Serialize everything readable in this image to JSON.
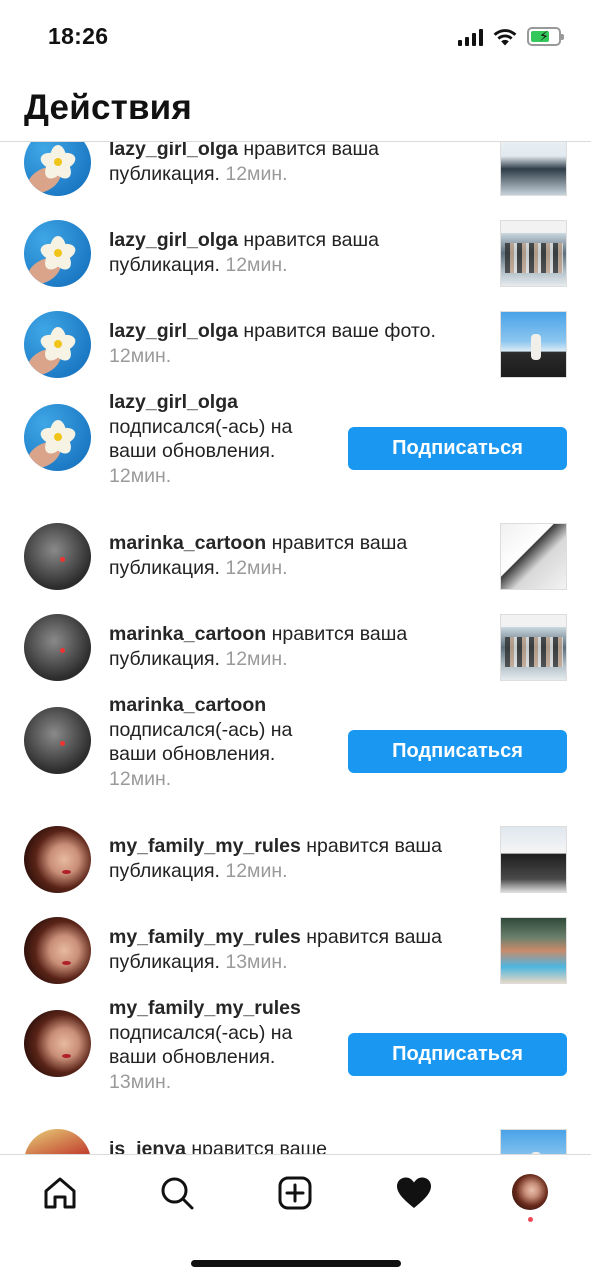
{
  "status_bar": {
    "time": "18:26"
  },
  "header": {
    "title": "Действия"
  },
  "notifications": [
    {
      "type": "like",
      "username": "lazy_girl_olga",
      "action": " нравится ваша публикация. ",
      "time": "12мин."
    },
    {
      "type": "like",
      "username": "lazy_girl_olga",
      "action": " нравится ваша публикация. ",
      "time": "12мин."
    },
    {
      "type": "like",
      "username": "lazy_girl_olga",
      "action": " нравится ваше фото. ",
      "time": "12мин."
    },
    {
      "type": "follow",
      "username": "lazy_girl_olga",
      "action": " подписался(-ась) на ваши обновления. ",
      "time": "12мин.",
      "button": "Подписаться"
    },
    {
      "type": "like",
      "username": "marinka_cartoon",
      "action": " нравится ваша публикация. ",
      "time": "12мин."
    },
    {
      "type": "like",
      "username": "marinka_cartoon",
      "action": " нравится ваша публикация. ",
      "time": "12мин."
    },
    {
      "type": "follow",
      "username": "marinka_cartoon",
      "action": " подписался(-ась) на ваши обновления. ",
      "time": "12мин.",
      "button": "Подписаться"
    },
    {
      "type": "like",
      "username": "my_family_my_rules",
      "action": " нравится ваша публикация. ",
      "time": "12мин."
    },
    {
      "type": "like",
      "username": "my_family_my_rules",
      "action": " нравится ваша публикация. ",
      "time": "13мин."
    },
    {
      "type": "follow",
      "username": "my_family_my_rules",
      "action": " подписался(-ась) на ваши обновления. ",
      "time": "13мин.",
      "button": "Подписаться"
    },
    {
      "type": "like",
      "username": "is_jenya",
      "action": " нравится ваше",
      "time": ""
    }
  ],
  "bottom_nav": {
    "items": [
      "home-icon",
      "search-icon",
      "add-post-icon",
      "heart-icon",
      "profile-avatar"
    ],
    "active": "heart-icon"
  },
  "colors": {
    "accent": "#1a98f1",
    "muted": "#9a9a9a",
    "notification_dot": "#ed4956"
  }
}
